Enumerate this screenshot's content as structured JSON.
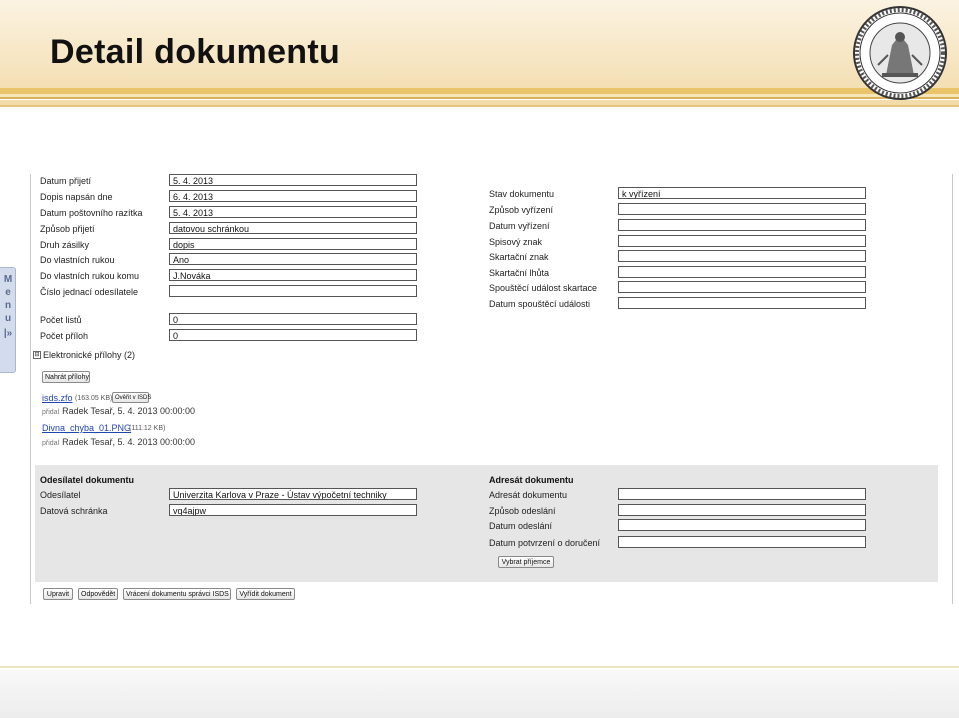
{
  "slide": {
    "title": "Detail dokumentu"
  },
  "menu": {
    "letters": [
      "M",
      "e",
      "n",
      "u",
      "|»"
    ]
  },
  "left_fields": [
    {
      "label": "Datum přijetí",
      "value": "5. 4. 2013"
    },
    {
      "label": "Dopis napsán dne",
      "value": "6. 4. 2013"
    },
    {
      "label": "Datum poštovního razítka",
      "value": "5. 4. 2013"
    },
    {
      "label": "Způsob přijetí",
      "value": "datovou schránkou"
    },
    {
      "label": "Druh zásilky",
      "value": "dopis"
    },
    {
      "label": "Do vlastních rukou",
      "value": "Ano"
    },
    {
      "label": "Do vlastních rukou komu",
      "value": "J.Nováka"
    },
    {
      "label": "Číslo jednací odesílatele",
      "value": ""
    }
  ],
  "count_fields": [
    {
      "label": "Počet listů",
      "value": "0"
    },
    {
      "label": "Počet příloh",
      "value": "0"
    }
  ],
  "right_fields": [
    {
      "label": "Stav dokumentu",
      "value": "k vyřízení"
    },
    {
      "label": "Způsob vyřízení",
      "value": ""
    },
    {
      "label": "Datum vyřízení",
      "value": ""
    },
    {
      "label": "Spisový znak",
      "value": ""
    },
    {
      "label": "Skartační znak",
      "value": ""
    },
    {
      "label": "Skartační lhůta",
      "value": ""
    },
    {
      "label": "Spouštěcí událost skartace",
      "value": ""
    },
    {
      "label": "Datum spouštěcí události",
      "value": ""
    }
  ],
  "attachments": {
    "toggle": "⊟",
    "heading": "Elektronické přílohy (2)",
    "upload_button": "Nahrát přílohy",
    "files": [
      {
        "name": "isds.zfo",
        "size": "(163.05 KB)",
        "verify_button": "Ověřit v ISDS",
        "added_prefix": "přidal",
        "added_by": "Radek Tesař, 5. 4. 2013 00:00:00"
      },
      {
        "name": "Divna_chyba_01.PNG",
        "size": "(111.12 KB)",
        "verify_button": "",
        "added_prefix": "přidal",
        "added_by": "Radek Tesař, 5. 4. 2013 00:00:00"
      }
    ]
  },
  "sender": {
    "heading": "Odesílatel dokumentu",
    "fields": [
      {
        "label": "Odesílatel",
        "value": "Univerzita Karlova v Praze - Ústav výpočetní techniky"
      },
      {
        "label": "Datová schránka",
        "value": "vq4ajpw"
      }
    ]
  },
  "recipient": {
    "heading": "Adresát dokumentu",
    "fields": [
      {
        "label": "Adresát dokumentu",
        "value": ""
      },
      {
        "label": "Způsob odeslání",
        "value": ""
      },
      {
        "label": "Datum odeslání",
        "value": ""
      },
      {
        "label": "Datum potvrzení o doručení",
        "value": ""
      }
    ],
    "select_button": "Vybrat příjemce"
  },
  "actions": {
    "edit": "Upravit",
    "reply": "Odpovědět",
    "return": "Vrácení dokumentu správci ISDS",
    "resolve": "Vyřídit dokument"
  }
}
